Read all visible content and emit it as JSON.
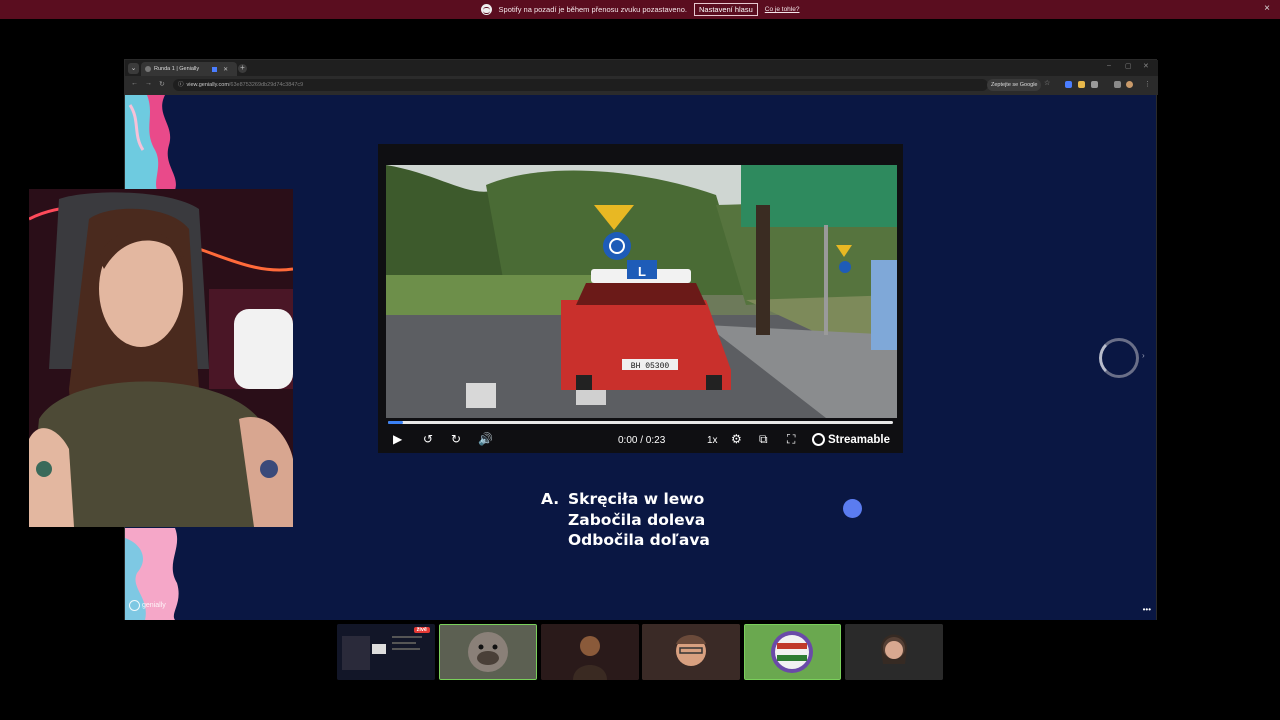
{
  "notification": {
    "message": "Spotify na pozadí je během přenosu zvuku pozastaveno.",
    "button_label": "Nastavení hlasu",
    "link_label": "Co je tohle?",
    "close": "×"
  },
  "browser": {
    "tab_title": "Runda 1 | Genially",
    "url_host": "view.genially.com",
    "url_path": "/63e8753269db29d74c3847c9",
    "google_label": "Zeptejte se Google",
    "window_controls": [
      "–",
      "▢",
      "✕"
    ]
  },
  "video": {
    "time": "0:00 / 0:23",
    "speed": "1x",
    "brand": "Streamable",
    "progress": 0.03,
    "plate": "BH 05300"
  },
  "answer": {
    "letter": "A.",
    "lines": [
      "Skręciła w lewo",
      "Zabočila doleva",
      "Odbočila doľava"
    ]
  },
  "genially_logo": "genially",
  "participants": {
    "live_badge": "živě"
  },
  "colors": {
    "notification_bg": "#5a0d1f",
    "slide_bg": "#0a1743",
    "accent_dot": "#5b7cf0",
    "active_tile_border": "#7ad05b"
  }
}
